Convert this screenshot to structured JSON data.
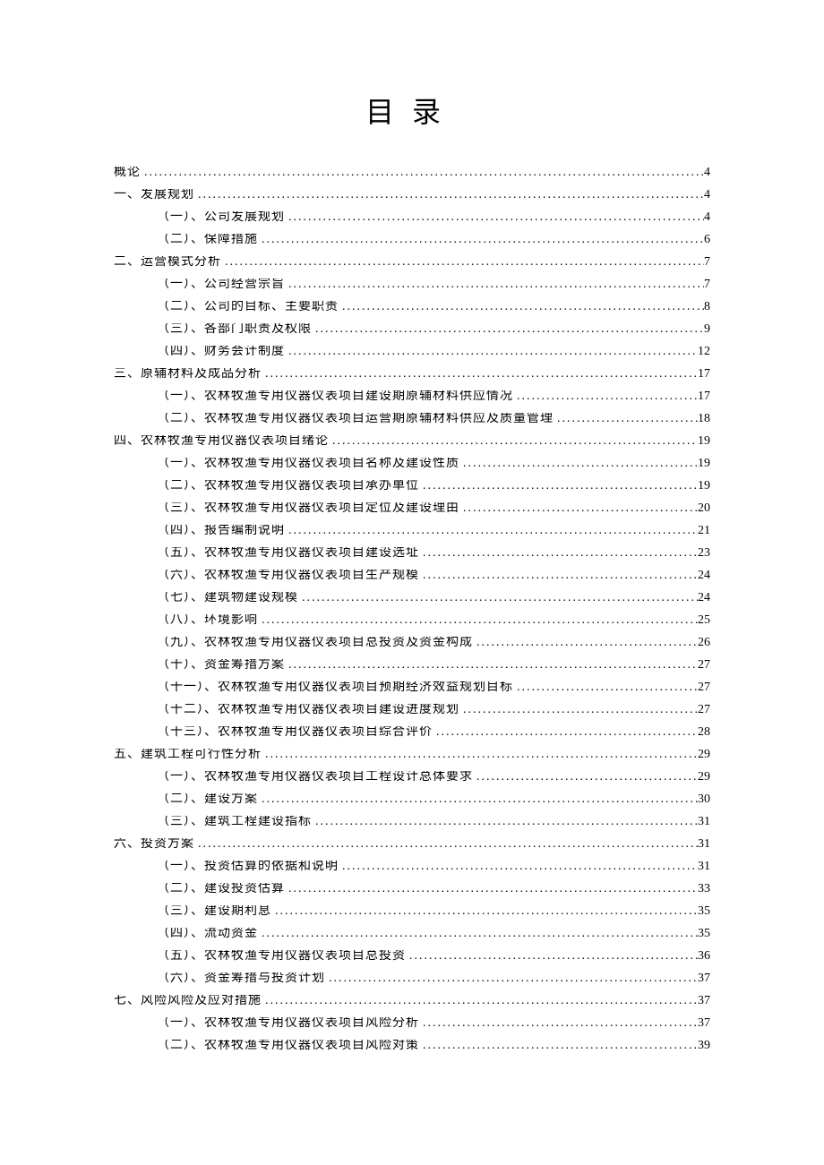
{
  "title": "目录",
  "toc": [
    {
      "level": 0,
      "label": "概论",
      "page": "4",
      "spaced": false
    },
    {
      "level": 1,
      "label": "一、发展规划",
      "page": "4",
      "spaced": false
    },
    {
      "level": 2,
      "label": "（一）、公司发展规划",
      "page": "4",
      "spaced": false
    },
    {
      "level": 2,
      "label": "（二）、保障措施",
      "page": "6",
      "spaced": false
    },
    {
      "level": 1,
      "label": "二、运营模式分析",
      "page": "7",
      "spaced": true
    },
    {
      "level": 2,
      "label": "（一）、公司经营宗旨",
      "page": "7",
      "spaced": false
    },
    {
      "level": 2,
      "label": "（二）、公司的目标、主要职责",
      "page": "8",
      "spaced": false
    },
    {
      "level": 2,
      "label": "（三）、各部门职责及权限",
      "page": "9",
      "spaced": false
    },
    {
      "level": 2,
      "label": "（四）、财务会计制度",
      "page": "12",
      "spaced": false
    },
    {
      "level": 1,
      "label": "三、原辅材料及成品分析",
      "page": "17",
      "spaced": false
    },
    {
      "level": 2,
      "label": "（一）、农林牧渔专用仪器仪表项目建设期原辅材料供应情况",
      "page": "17",
      "spaced": false
    },
    {
      "level": 2,
      "label": "（二）、农林牧渔专用仪器仪表项目运营期原辅材料供应及质量管理",
      "page": "18",
      "spaced": false
    },
    {
      "level": 1,
      "label": "四、农林牧渔专用仪器仪表项目绪论",
      "page": "19",
      "spaced": true
    },
    {
      "level": 2,
      "label": "（一）、农林牧渔专用仪器仪表项目名称及建设性质",
      "page": "19",
      "spaced": false
    },
    {
      "level": 2,
      "label": "（二）、农林牧渔专用仪器仪表项目承办单位",
      "page": "19",
      "spaced": false
    },
    {
      "level": 2,
      "label": "（三）、农林牧渔专用仪器仪表项目定位及建设理由",
      "page": "20",
      "spaced": true
    },
    {
      "level": 2,
      "label": "（四）、报告编制说明",
      "page": "21",
      "spaced": false
    },
    {
      "level": 2,
      "label": "（五）、农林牧渔专用仪器仪表项目建设选址",
      "page": "23",
      "spaced": false
    },
    {
      "level": 2,
      "label": "（六）、农林牧渔专用仪器仪表项目生产规模",
      "page": "24",
      "spaced": true
    },
    {
      "level": 2,
      "label": "（七）、建筑物建设规模",
      "page": "24",
      "spaced": false
    },
    {
      "level": 2,
      "label": "（八）、环境影响",
      "page": "25",
      "spaced": false
    },
    {
      "level": 2,
      "label": "（九）、农林牧渔专用仪器仪表项目总投资及资金构成",
      "page": "26",
      "spaced": false
    },
    {
      "level": 2,
      "label": "（十）、资金筹措方案",
      "page": "27",
      "spaced": false
    },
    {
      "level": 2,
      "label": "（十一）、农林牧渔专用仪器仪表项目预期经济效益规划目标",
      "page": "27",
      "spaced": false
    },
    {
      "level": 2,
      "label": "（十二）、农林牧渔专用仪器仪表项目建设进度规划",
      "page": "27",
      "spaced": false
    },
    {
      "level": 2,
      "label": "（十三）、农林牧渔专用仪器仪表项目综合评价",
      "page": "28",
      "spaced": false
    },
    {
      "level": 1,
      "label": "五、建筑工程可行性分析",
      "page": "29",
      "spaced": false
    },
    {
      "level": 2,
      "label": "（一）、农林牧渔专用仪器仪表项目工程设计总体要求",
      "page": "29",
      "spaced": false
    },
    {
      "level": 2,
      "label": "（二）、建设方案",
      "page": "30",
      "spaced": false
    },
    {
      "level": 2,
      "label": "（三）、建筑工程建设指标",
      "page": "31",
      "spaced": true
    },
    {
      "level": 1,
      "label": "六、投资方案",
      "page": "31",
      "spaced": false
    },
    {
      "level": 2,
      "label": "（一）、投资估算的依据和说明",
      "page": "31",
      "spaced": false
    },
    {
      "level": 2,
      "label": "（二）、建设投资估算",
      "page": "33",
      "spaced": false
    },
    {
      "level": 2,
      "label": "（三）、建设期利息",
      "page": "35",
      "spaced": false
    },
    {
      "level": 2,
      "label": "（四）、流动资金",
      "page": "35",
      "spaced": false
    },
    {
      "level": 2,
      "label": "（五）、农林牧渔专用仪器仪表项目总投资",
      "page": "36",
      "spaced": false
    },
    {
      "level": 2,
      "label": "（六）、资金筹措与投资计划",
      "page": "37",
      "spaced": false
    },
    {
      "level": 1,
      "label": "七、风险风险及应对措施",
      "page": "37",
      "spaced": false
    },
    {
      "level": 2,
      "label": "（一）、农林牧渔专用仪器仪表项目风险分析",
      "page": "37",
      "spaced": false
    },
    {
      "level": 2,
      "label": "（二）、农林牧渔专用仪器仪表项目风险对策",
      "page": "39",
      "spaced": false
    }
  ]
}
